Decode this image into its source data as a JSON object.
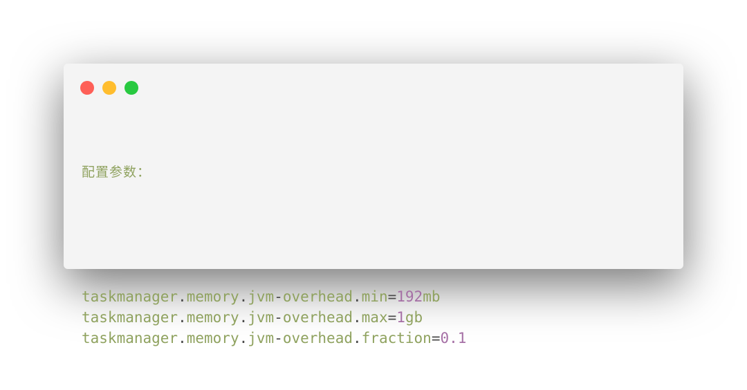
{
  "window": {
    "controls": [
      {
        "name": "close-button",
        "color": "#fe5f57"
      },
      {
        "name": "minimize-button",
        "color": "#ffbd2e"
      },
      {
        "name": "zoom-button",
        "color": "#28c940"
      }
    ]
  },
  "colors": {
    "background": "#f4f4f4",
    "identifier": "#8fa25f",
    "punctuation": "#4a4a4a",
    "number": "#a56fa5",
    "comment": "#8fa25f"
  },
  "code": {
    "comment": "配置参数：",
    "lines": [
      {
        "tokens": [
          {
            "text": "taskmanager",
            "kind": "identifier"
          },
          {
            "text": ".",
            "kind": "punctuation"
          },
          {
            "text": "memory",
            "kind": "identifier"
          },
          {
            "text": ".",
            "kind": "punctuation"
          },
          {
            "text": "jvm",
            "kind": "identifier"
          },
          {
            "text": "-",
            "kind": "punctuation"
          },
          {
            "text": "overhead",
            "kind": "identifier"
          },
          {
            "text": ".",
            "kind": "punctuation"
          },
          {
            "text": "min",
            "kind": "identifier"
          },
          {
            "text": "=",
            "kind": "punctuation"
          },
          {
            "text": "192",
            "kind": "number"
          },
          {
            "text": "mb",
            "kind": "identifier"
          }
        ]
      },
      {
        "tokens": [
          {
            "text": "taskmanager",
            "kind": "identifier"
          },
          {
            "text": ".",
            "kind": "punctuation"
          },
          {
            "text": "memory",
            "kind": "identifier"
          },
          {
            "text": ".",
            "kind": "punctuation"
          },
          {
            "text": "jvm",
            "kind": "identifier"
          },
          {
            "text": "-",
            "kind": "punctuation"
          },
          {
            "text": "overhead",
            "kind": "identifier"
          },
          {
            "text": ".",
            "kind": "punctuation"
          },
          {
            "text": "max",
            "kind": "identifier"
          },
          {
            "text": "=",
            "kind": "punctuation"
          },
          {
            "text": "1",
            "kind": "number"
          },
          {
            "text": "gb",
            "kind": "identifier"
          }
        ]
      },
      {
        "tokens": [
          {
            "text": "taskmanager",
            "kind": "identifier"
          },
          {
            "text": ".",
            "kind": "punctuation"
          },
          {
            "text": "memory",
            "kind": "identifier"
          },
          {
            "text": ".",
            "kind": "punctuation"
          },
          {
            "text": "jvm",
            "kind": "identifier"
          },
          {
            "text": "-",
            "kind": "punctuation"
          },
          {
            "text": "overhead",
            "kind": "identifier"
          },
          {
            "text": ".",
            "kind": "punctuation"
          },
          {
            "text": "fraction",
            "kind": "identifier"
          },
          {
            "text": "=",
            "kind": "punctuation"
          },
          {
            "text": "0.1",
            "kind": "number"
          }
        ]
      }
    ]
  }
}
